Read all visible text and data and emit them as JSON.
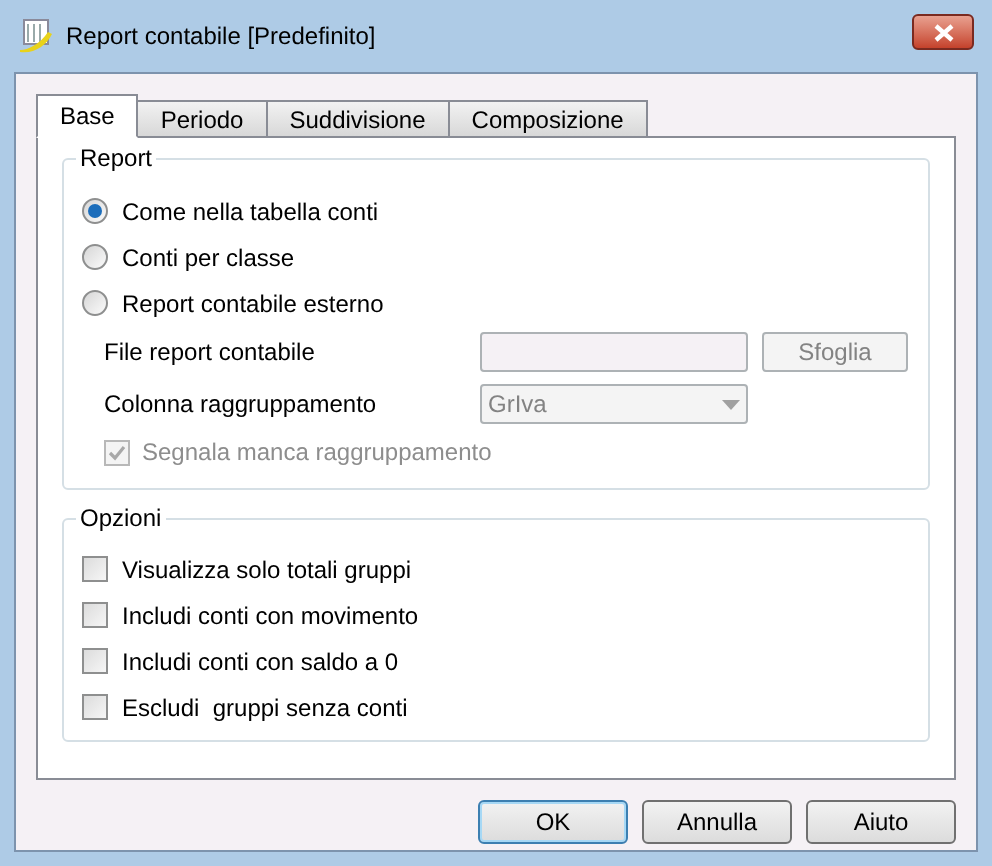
{
  "window": {
    "title": "Report contabile [Predefinito]"
  },
  "tabs": [
    {
      "label": "Base",
      "selected": true
    },
    {
      "label": "Periodo",
      "selected": false
    },
    {
      "label": "Suddivisione",
      "selected": false
    },
    {
      "label": "Composizione",
      "selected": false
    }
  ],
  "report_group": {
    "title": "Report",
    "options": [
      {
        "label": "Come nella tabella conti",
        "selected": true
      },
      {
        "label": "Conti per classe",
        "selected": false
      },
      {
        "label": "Report contabile esterno",
        "selected": false
      }
    ],
    "file_label": "File report contabile",
    "file_field": {
      "disabled": true
    },
    "browse_button": "Sfoglia",
    "column_label": "Colonna raggruppamento",
    "column_select": {
      "value": "GrIva",
      "disabled": true
    },
    "flag": {
      "label": "Segnala manca raggruppamento",
      "checked": true,
      "disabled": true
    }
  },
  "options_group": {
    "title": "Opzioni",
    "items": [
      {
        "label": "Visualizza solo totali gruppi",
        "checked": false
      },
      {
        "label": "Includi conti con movimento",
        "checked": false
      },
      {
        "label": "Includi conti con saldo a 0",
        "checked": false
      },
      {
        "label": "Escludi  gruppi senza conti",
        "checked": false
      }
    ]
  },
  "buttons": [
    {
      "label": "OK",
      "default": true
    },
    {
      "label": "Annulla",
      "default": false
    },
    {
      "label": "Aiuto",
      "default": false
    }
  ]
}
